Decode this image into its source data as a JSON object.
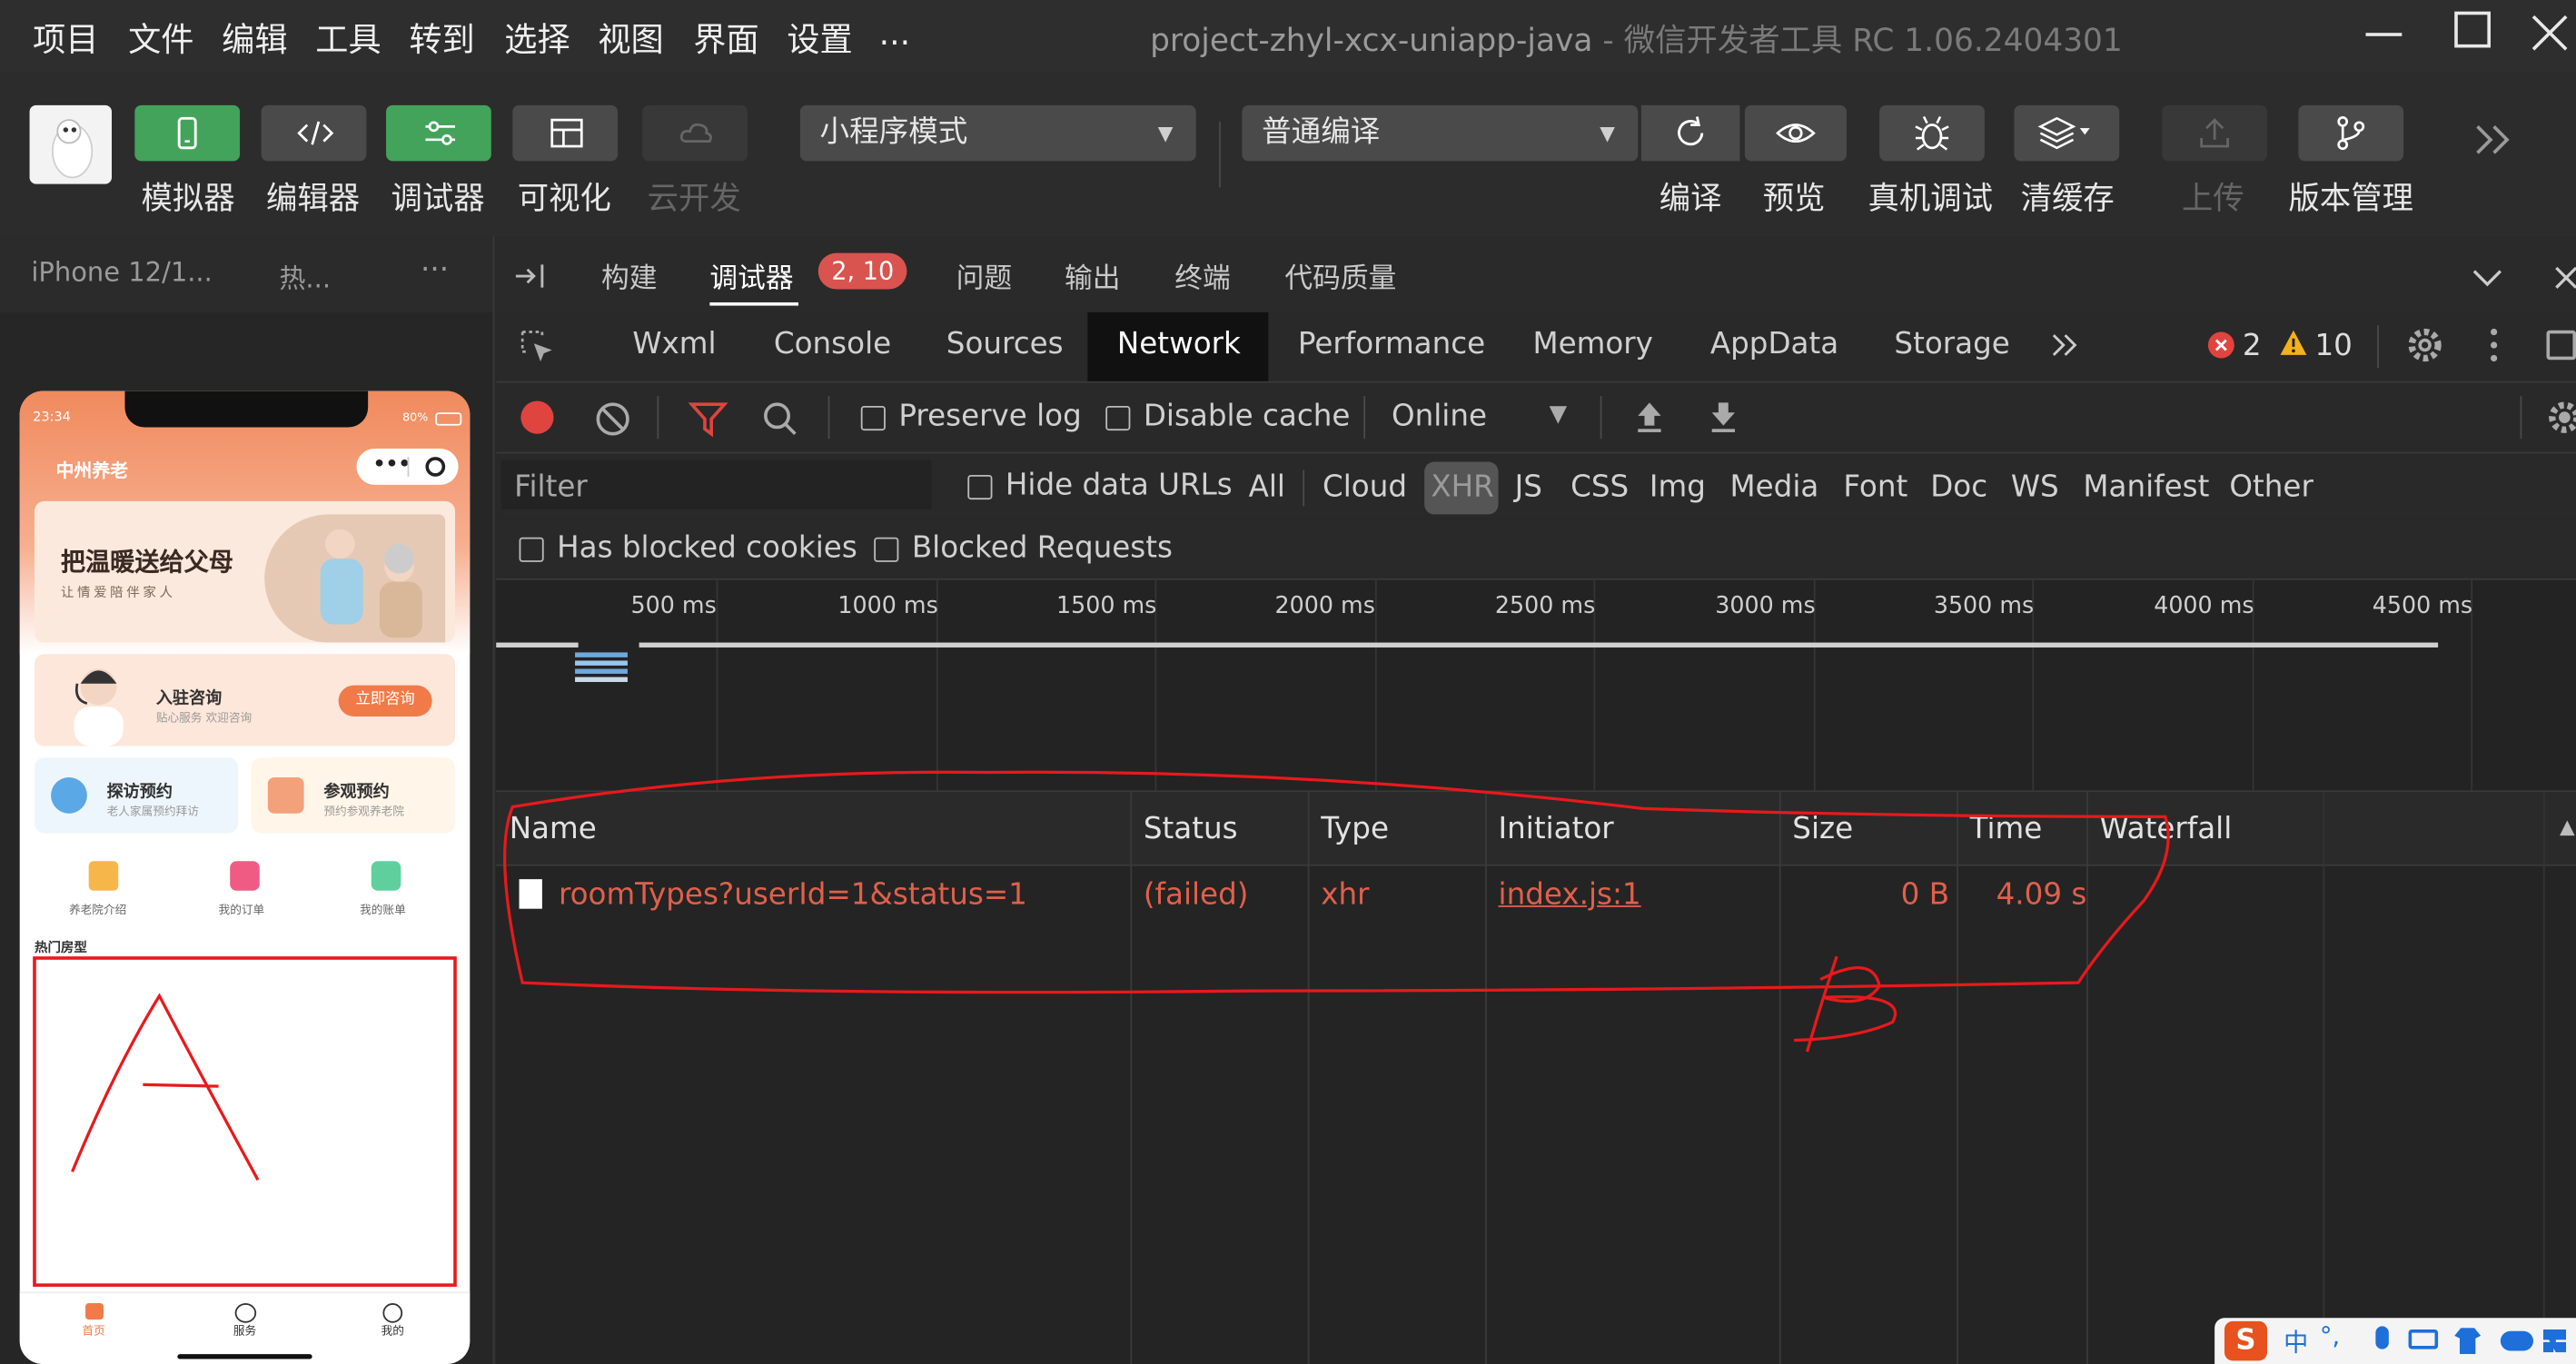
{
  "menu": {
    "items": [
      "项目",
      "文件",
      "编辑",
      "工具",
      "转到",
      "选择",
      "视图",
      "界面",
      "设置",
      "..."
    ],
    "window_title_project": "project-zhyl-xcx-uniapp-java",
    "window_title_sep": "-",
    "window_title_app": "微信开发者工具 RC 1.06.2404301"
  },
  "toolbar": {
    "simulator": "模拟器",
    "editor": "编辑器",
    "debugger": "调试器",
    "visual": "可视化",
    "cloud": "云开发",
    "mode_select": "小程序模式",
    "compile_select": "普通编译",
    "compile": "编译",
    "preview": "预览",
    "device_debug": "真机调试",
    "clear_cache": "清缓存",
    "upload": "上传",
    "version": "版本管理"
  },
  "sim": {
    "device_tab": "iPhone 12/1...",
    "hot_tab": "热...",
    "more": "···"
  },
  "phone": {
    "time": "23:34",
    "battery": "80%",
    "app_title": "中州养老",
    "banner_title": "把温暖送给父母",
    "banner_sub": "让情爱陪伴家人",
    "consult_title": "入驻咨询",
    "consult_sub": "贴心服务 欢迎咨询",
    "consult_button": "立即咨询",
    "visit_title": "探访预约",
    "visit_sub": "老人家属预约拜访",
    "tour_title": "参观预约",
    "tour_sub": "预约参观养老院",
    "icon1_label": "养老院介绍",
    "icon2_label": "我的订单",
    "icon3_label": "我的账单",
    "hot_rooms": "热门房型",
    "nav_home": "首页",
    "nav_service": "服务",
    "nav_mine": "我的"
  },
  "devtools": {
    "panel_tabs": [
      "构建",
      "调试器",
      "问题",
      "输出",
      "终端",
      "代码质量"
    ],
    "debugger_badge": "2, 10",
    "inner_tabs": [
      "Wxml",
      "Console",
      "Sources",
      "Network",
      "Performance",
      "Memory",
      "AppData",
      "Storage"
    ],
    "error_count": "2",
    "warn_count": "10",
    "preserve_log": "Preserve log",
    "disable_cache": "Disable cache",
    "throttle": "Online",
    "filter_placeholder": "Filter",
    "hide_data_urls": "Hide data URLs",
    "filter_types": [
      "All",
      "Cloud",
      "XHR",
      "JS",
      "CSS",
      "Img",
      "Media",
      "Font",
      "Doc",
      "WS",
      "Manifest",
      "Other"
    ],
    "has_blocked_cookies": "Has blocked cookies",
    "blocked_requests": "Blocked Requests",
    "timeline_ticks": [
      "500 ms",
      "1000 ms",
      "1500 ms",
      "2000 ms",
      "2500 ms",
      "3000 ms",
      "3500 ms",
      "4000 ms",
      "4500 ms"
    ],
    "columns": [
      "Name",
      "Status",
      "Type",
      "Initiator",
      "Size",
      "Time",
      "Waterfall"
    ],
    "request": {
      "name": "roomTypes?userId=1&status=1",
      "status": "(failed)",
      "type": "xhr",
      "initiator": "index.js:1",
      "size": "0 B",
      "time": "4.09 s"
    }
  },
  "colors": {
    "accent_green": "#43a35a",
    "error_red": "#e0604a",
    "annotation_red": "#e8191c",
    "phone_orange": "#f08a5d"
  },
  "icons": [
    "robot-avatar",
    "phone-icon",
    "code-icon",
    "sliders-icon",
    "layout-icon",
    "cloud-icon",
    "refresh-icon",
    "eye-icon",
    "bug-icon",
    "layers-icon",
    "upload-icon",
    "branch-icon",
    "chevrons-icon",
    "record-icon",
    "block-icon",
    "filter-icon",
    "search-icon",
    "upload-arrow-icon",
    "download-arrow-icon",
    "gear-icon",
    "kebab-icon",
    "dock-icon"
  ]
}
